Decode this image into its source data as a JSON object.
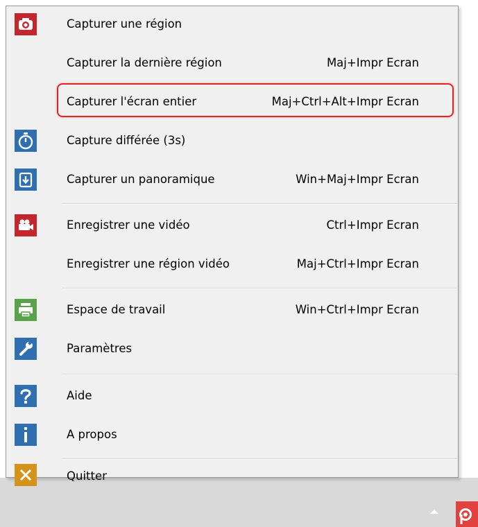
{
  "menu": {
    "items": [
      {
        "label": "Capturer une région",
        "shortcut": "",
        "icon": "camera-icon",
        "color": "#c4262e"
      },
      {
        "label": "Capturer la dernière région",
        "shortcut": "Maj+Impr Ecran",
        "icon": "",
        "color": ""
      },
      {
        "label": "Capturer l'écran entier",
        "shortcut": "Maj+Ctrl+Alt+Impr Ecran",
        "icon": "",
        "color": ""
      },
      {
        "label": "Capture différée (3s)",
        "shortcut": "",
        "icon": "stopwatch-icon",
        "color": "#2f6fb0"
      },
      {
        "label": "Capturer un panoramique",
        "shortcut": "Win+Maj+Impr Ecran",
        "icon": "panorama-icon",
        "color": "#2f6fb0"
      },
      {
        "label": "Enregistrer une vidéo",
        "shortcut": "Ctrl+Impr Ecran",
        "icon": "video-camera-icon",
        "color": "#c4262e"
      },
      {
        "label": "Enregistrer une région vidéo",
        "shortcut": "Maj+Ctrl+Impr Ecran",
        "icon": "",
        "color": ""
      },
      {
        "label": "Espace de travail",
        "shortcut": "Win+Ctrl+Impr Ecran",
        "icon": "workspace-printer-icon",
        "color": "#5aa24a"
      },
      {
        "label": "Paramètres",
        "shortcut": "",
        "icon": "wrench-icon",
        "color": "#2f6fb0"
      },
      {
        "label": "Aide",
        "shortcut": "",
        "icon": "question-mark-icon",
        "color": "#2f6fb0"
      },
      {
        "label": "A propos",
        "shortcut": "",
        "icon": "info-icon",
        "color": "#2f6fb0"
      },
      {
        "label": "Quitter",
        "shortcut": "",
        "icon": "close-x-icon",
        "color": "#d4931a"
      }
    ],
    "highlight_color": "#e02424"
  },
  "taskbar": {
    "background": "#d9d9d9",
    "tray_app_letter": "P",
    "tray_app_color": "#e2423f"
  }
}
